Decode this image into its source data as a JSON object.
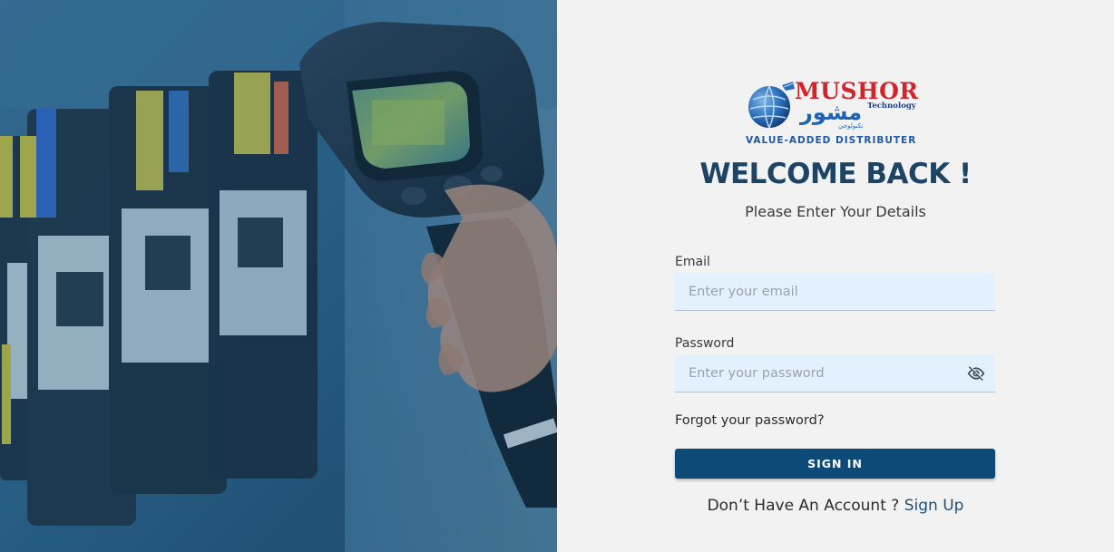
{
  "brand": {
    "name_en": "MUSHOR",
    "name_ar": "مشور",
    "name_ar_small": "تكنولوجي",
    "technology": "Technology",
    "tagline": "VALUE-ADDED DISTRIBUTER"
  },
  "login": {
    "title": "WELCOME BACK !",
    "subtitle": "Please Enter Your Details",
    "email": {
      "label": "Email",
      "placeholder": "Enter your email",
      "value": ""
    },
    "password": {
      "label": "Password",
      "placeholder": "Enter your password",
      "value": "",
      "toggle_icon": "eye-off-icon"
    },
    "forgot_label": "Forgot your password?",
    "sign_in_label": "SIGN IN",
    "no_account_text": "Don’t Have An Account ?",
    "sign_up_label": "Sign Up"
  },
  "colors": {
    "primary": "#0e4a77",
    "title": "#1d4464",
    "input_bg": "#e3f0fd",
    "panel_bg": "#f2f2f2",
    "brand_red": "#d3232b",
    "brand_blue": "#1c64b8"
  },
  "hero": {
    "icon": "thermal-camera-image"
  }
}
